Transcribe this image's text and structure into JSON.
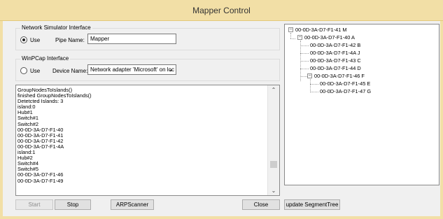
{
  "window": {
    "title": "Mapper Control"
  },
  "network_simulator": {
    "group_label": "Network Simulator Interface",
    "use_label": "Use",
    "use_checked": true,
    "pipe_name_label": "Pipe Name:",
    "pipe_name_value": "Mapper"
  },
  "winpcap": {
    "group_label": "WinPCap Interface",
    "use_label": "Use",
    "use_checked": false,
    "device_name_label": "Device Name:",
    "device_name_value": "Network adapter 'Microsoft' on loc"
  },
  "log": {
    "lines": [
      "GroupNodesToIslands()",
      "finished GroupNodesToIslands()",
      "Detetcted Islands: 3",
      "island:0",
      "Hub#1",
      "Switch#1",
      "Switch#2",
      "00-0D-3A-D7-F1-40",
      "00-0D-3A-D7-F1-41",
      "00-0D-3A-D7-F1-42",
      "00-0D-3A-D7-F1-4A",
      "island:1",
      "Hub#2",
      "Switch#4",
      "Switch#5",
      "00-0D-3A-D7-F1-46",
      "00-0D-3A-D7-F1-49"
    ]
  },
  "buttons": {
    "start": "Start",
    "stop": "Stop",
    "arp_scanner": "ARPScanner",
    "close": "Close",
    "update_segment_tree": "update SegmentTree"
  },
  "tree": {
    "root": "00-0D-3A-D7-F1-41 M",
    "n1": "00-0D-3A-D7-F1-40 A",
    "n1_children": [
      "00-0D-3A-D7-F1-42 B",
      "00-0D-3A-D7-F1-4A J",
      "00-0D-3A-D7-F1-43 C",
      "00-0D-3A-D7-F1-44 D"
    ],
    "n2": "00-0D-3A-D7-F1-46 F",
    "n2_children": [
      "00-0D-3A-D7-F1-45 E",
      "00-0D-3A-D7-F1-47 G"
    ]
  },
  "colors": {
    "title_bar": "#f2dfa6"
  }
}
